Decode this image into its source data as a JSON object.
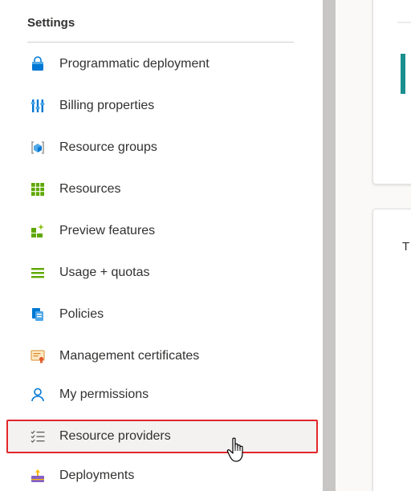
{
  "settings": {
    "title": "Settings",
    "items": [
      {
        "label": "Programmatic deployment",
        "icon": "shopping-bag-icon"
      },
      {
        "label": "Billing properties",
        "icon": "sliders-icon"
      },
      {
        "label": "Resource groups",
        "icon": "resource-group-icon"
      },
      {
        "label": "Resources",
        "icon": "grid-icon"
      },
      {
        "label": "Preview features",
        "icon": "preview-features-icon"
      },
      {
        "label": "Usage + quotas",
        "icon": "usage-list-icon"
      },
      {
        "label": "Policies",
        "icon": "policy-document-icon"
      },
      {
        "label": "Management certificates",
        "icon": "certificate-icon"
      },
      {
        "label": "My permissions",
        "icon": "person-icon"
      },
      {
        "label": "Resource providers",
        "icon": "checklist-icon",
        "selected": true
      },
      {
        "label": "Deployments",
        "icon": "deployment-icon"
      }
    ]
  },
  "content": {
    "card2_partial_text": "T"
  },
  "colors": {
    "accent_teal": "#1b8e8e",
    "highlight_border": "#e3262b",
    "selected_bg": "#f3f2f1"
  }
}
